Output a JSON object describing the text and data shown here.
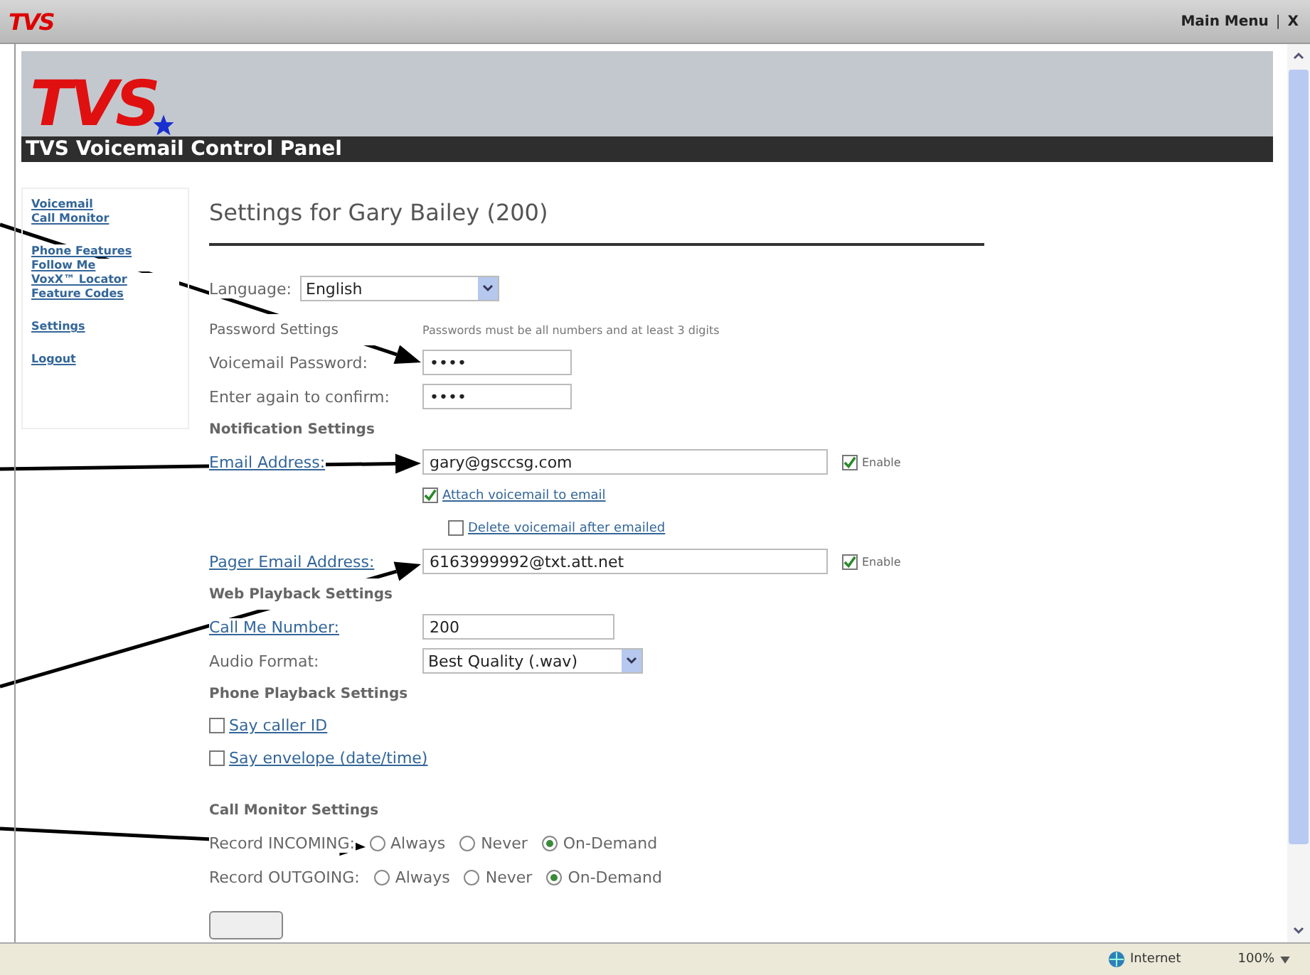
{
  "topbar": {
    "logo_text": "TVS",
    "menu_link": "Main Menu",
    "separator": "|",
    "close": "X"
  },
  "banner": {
    "logo_text": "TVS",
    "title": "TVS Voicemail Control Panel"
  },
  "nav_groups": [
    [
      "Voicemail",
      "Call Monitor"
    ],
    [
      "Phone Features",
      "Follow Me",
      "VoxX™ Locator",
      "Feature Codes"
    ],
    [
      "Settings"
    ],
    [
      "Logout"
    ]
  ],
  "page_title": "Settings for Gary Bailey (200)",
  "language": {
    "label": "Language:",
    "value": "English"
  },
  "password": {
    "heading": "Password Settings",
    "hint": "Passwords must be all numbers and at least 3 digits",
    "rows": [
      {
        "label": "Voicemail Password:",
        "value": "••••"
      },
      {
        "label": "Enter again to confirm:",
        "value": "••••"
      }
    ]
  },
  "notification": {
    "heading": "Notification Settings",
    "email": {
      "label": "Email Address:",
      "value": "gary@gsccsg.com",
      "enable_label": "Enable",
      "enabled": true
    },
    "options": [
      {
        "label": "Attach voicemail to email",
        "checked": true
      },
      {
        "label": "Delete voicemail after emailed",
        "checked": false
      }
    ],
    "pager": {
      "label": "Pager Email Address:",
      "value": "6163999992@txt.att.net",
      "enable_label": "Enable",
      "enabled": true
    }
  },
  "web_playback": {
    "heading": "Web Playback Settings",
    "call_me": {
      "label": "Call Me Number:",
      "value": "200"
    },
    "audio_format": {
      "label": "Audio Format:",
      "value": "Best Quality (.wav)"
    }
  },
  "phone_playback": {
    "heading": "Phone Playback Settings",
    "options": [
      {
        "label": "Say caller ID",
        "checked": false
      },
      {
        "label": "Say envelope (date/time)",
        "checked": false
      }
    ]
  },
  "call_monitor": {
    "heading": "Call Monitor Settings",
    "rows": [
      {
        "label": "Record INCOMING:",
        "options": [
          {
            "label": "Always",
            "selected": false
          },
          {
            "label": "Never",
            "selected": false
          },
          {
            "label": "On-Demand",
            "selected": true
          }
        ]
      },
      {
        "label": "Record OUTGOING:",
        "options": [
          {
            "label": "Always",
            "selected": false
          },
          {
            "label": "Never",
            "selected": false
          },
          {
            "label": "On-Demand",
            "selected": true
          }
        ]
      }
    ]
  },
  "status_bar": {
    "zone": "Internet",
    "zoom": "100%"
  }
}
